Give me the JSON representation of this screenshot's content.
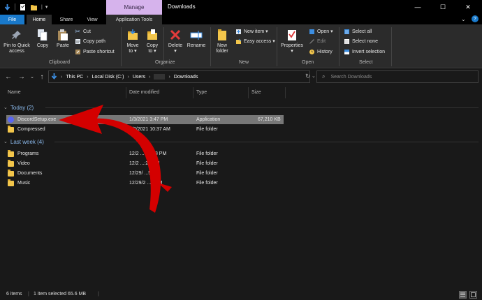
{
  "title_bar": {
    "manage_tab": "Manage",
    "title": "Downloads",
    "minimize": "—",
    "maximize": "☐",
    "close": "✕"
  },
  "tabs": {
    "file": "File",
    "home": "Home",
    "share": "Share",
    "view": "View",
    "app_tools": "Application Tools"
  },
  "ribbon": {
    "clipboard": {
      "pin": [
        "Pin to Quick",
        "access"
      ],
      "copy": "Copy",
      "paste": "Paste",
      "cut": "Cut",
      "copy_path": "Copy path",
      "paste_shortcut": "Paste shortcut",
      "label": "Clipboard"
    },
    "organize": {
      "move_to": [
        "Move",
        "to ▾"
      ],
      "copy_to": [
        "Copy",
        "to ▾"
      ],
      "delete": [
        "Delete",
        "▾"
      ],
      "rename": "Rename",
      "label": "Organize"
    },
    "new": {
      "new_folder": [
        "New",
        "folder"
      ],
      "new_item": "New item ▾",
      "easy_access": "Easy access ▾",
      "label": "New"
    },
    "open": {
      "properties": [
        "Properties",
        "▾"
      ],
      "open": "Open ▾",
      "edit": "Edit",
      "history": "History",
      "label": "Open"
    },
    "select": {
      "select_all": "Select all",
      "select_none": "Select none",
      "invert": "Invert selection",
      "label": "Select"
    }
  },
  "address": {
    "crumbs": [
      "This PC",
      "Local Disk (C:)",
      "Users",
      "Downloads"
    ],
    "search_placeholder": "Search Downloads"
  },
  "columns": {
    "name": "Name",
    "date": "Date modified",
    "type": "Type",
    "size": "Size"
  },
  "groups": [
    {
      "label": "Today (2)",
      "rows": [
        {
          "name": "DiscordSetup.exe",
          "date": "1/3/2021 3:47 PM",
          "type": "Application",
          "size": "67,210 KB",
          "icon": "discord-icon",
          "selected": true
        },
        {
          "name": "Compressed",
          "date": "1/3/2021 10:37 AM",
          "type": "File folder",
          "size": "",
          "icon": "folder-icon",
          "selected": false
        }
      ]
    },
    {
      "label": "Last week (4)",
      "rows": [
        {
          "name": "Programs",
          "date": "12/2 ...0 5:38 PM",
          "type": "File folder",
          "size": "",
          "icon": "folder-icon"
        },
        {
          "name": "Video",
          "date": "12/2 ...:23 PM",
          "type": "File folder",
          "size": "",
          "icon": "folder-icon"
        },
        {
          "name": "Documents",
          "date": "12/29/ ...5 PM",
          "type": "File folder",
          "size": "",
          "icon": "folder-icon"
        },
        {
          "name": "Music",
          "date": "12/29/2 ...0 PM",
          "type": "File folder",
          "size": "",
          "icon": "folder-icon"
        }
      ]
    }
  ],
  "status": {
    "items": "6 items",
    "selected": "1 item selected  65.6 MB"
  },
  "colors": {
    "file_tab": "#1979ca",
    "manage_tab": "#d6b3ec",
    "selection": "#777777",
    "annotation_arrow": "#d40000"
  }
}
